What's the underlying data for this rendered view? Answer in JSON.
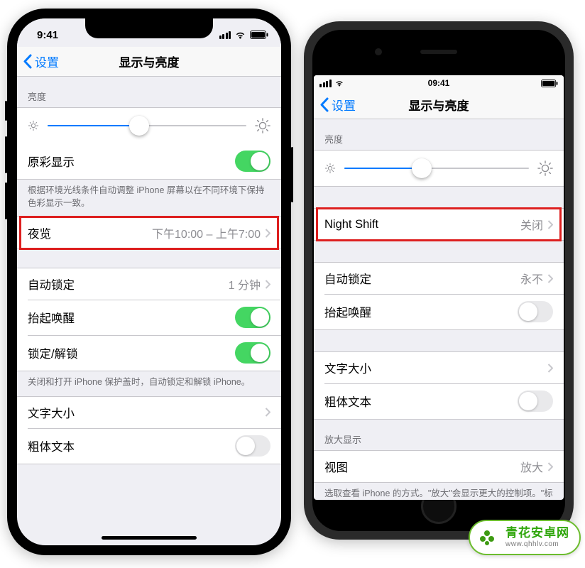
{
  "left": {
    "status_time": "9:41",
    "nav_back": "设置",
    "nav_title": "显示与亮度",
    "brightness_header": "亮度",
    "brightness_pct": 46,
    "truetone": {
      "label": "原彩显示",
      "on": true
    },
    "truetone_footer": "根据环境光线条件自动调整 iPhone 屏幕以在不同环境下保持色彩显示一致。",
    "nightshift": {
      "label": "夜览",
      "value": "下午10:00 – 上午7:00"
    },
    "autolock": {
      "label": "自动锁定",
      "value": "1 分钟"
    },
    "raise": {
      "label": "抬起唤醒",
      "on": true
    },
    "lockunlock": {
      "label": "锁定/解锁",
      "on": true
    },
    "lock_footer": "关闭和打开 iPhone 保护盖时，自动锁定和解锁 iPhone。",
    "textsize": "文字大小",
    "bold": {
      "label": "粗体文本",
      "on": false
    }
  },
  "right": {
    "status_time": "09:41",
    "nav_back": "设置",
    "nav_title": "显示与亮度",
    "brightness_header": "亮度",
    "brightness_pct": 42,
    "nightshift": {
      "label": "Night Shift",
      "value": "关闭"
    },
    "autolock": {
      "label": "自动锁定",
      "value": "永不"
    },
    "raise": {
      "label": "抬起唤醒",
      "on": false
    },
    "textsize": "文字大小",
    "bold": {
      "label": "粗体文本",
      "on": false
    },
    "zoom_header": "放大显示",
    "view": {
      "label": "视图",
      "value": "放大"
    },
    "zoom_footer": "选取查看 iPhone 的方式。\"放大\"会显示更大的控制项。\"标准\"会显示更多的内容。"
  },
  "watermark": {
    "name": "青花安卓网",
    "url": "www.qhhlv.com"
  }
}
